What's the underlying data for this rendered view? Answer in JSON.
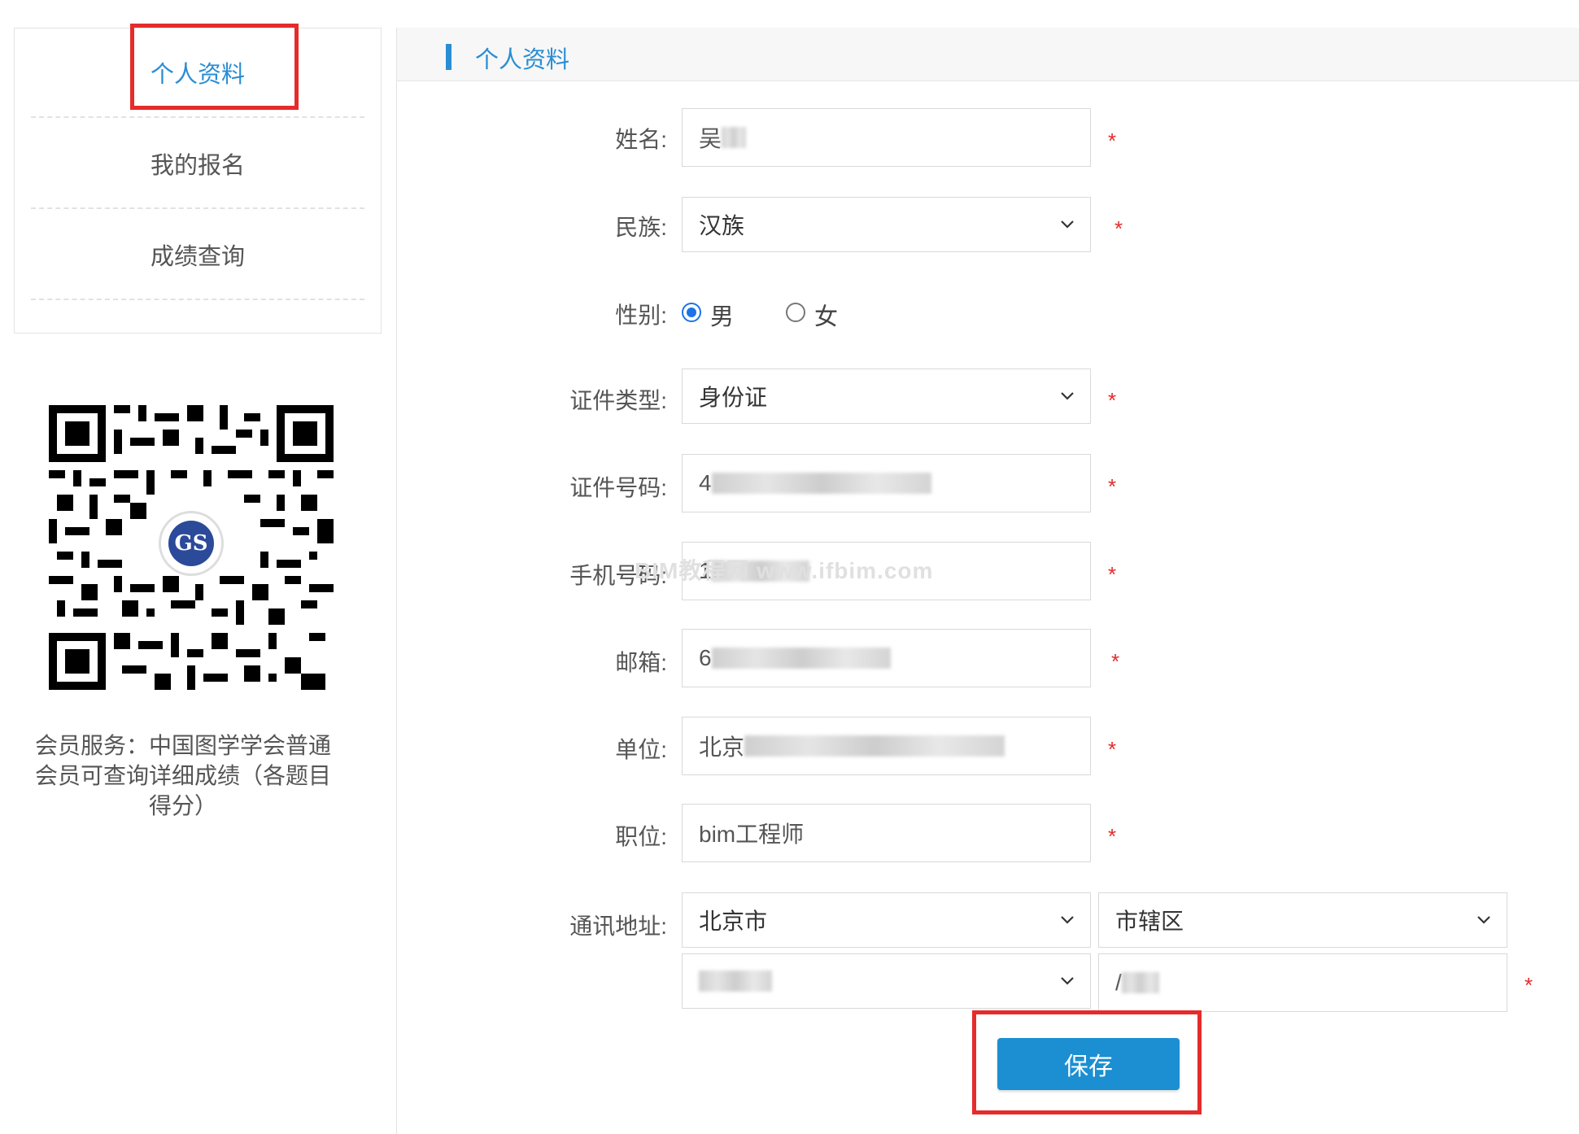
{
  "sidebar": {
    "items": [
      {
        "label": "个人资料",
        "active": true
      },
      {
        "label": "我的报名",
        "active": false
      },
      {
        "label": "成绩查询",
        "active": false
      }
    ]
  },
  "qr": {
    "logo_text": "GS"
  },
  "member_note": "会员服务：中国图学学会普通会员可查询详细成绩（各题目得分）",
  "header": {
    "title": "个人资料"
  },
  "form": {
    "name": {
      "label": "姓名:",
      "value": "吴"
    },
    "ethnicity": {
      "label": "民族:",
      "value": "汉族"
    },
    "gender": {
      "label": "性别:",
      "options": [
        "男",
        "女"
      ],
      "selected": "男"
    },
    "id_type": {
      "label": "证件类型:",
      "value": "身份证"
    },
    "id_number": {
      "label": "证件号码:",
      "value": "4"
    },
    "phone": {
      "label": "手机号码:",
      "value": "1"
    },
    "email": {
      "label": "邮箱:",
      "value": "6"
    },
    "unit": {
      "label": "单位:",
      "value": "北京"
    },
    "position": {
      "label": "职位:",
      "value": "bim工程师"
    },
    "address": {
      "label": "通讯地址:",
      "province": "北京市",
      "city": "市辖区",
      "district": "",
      "detail": "/"
    },
    "required_mark": "*"
  },
  "watermark": "BIM教程网 www.ifbim.com",
  "save_label": "保存",
  "colors": {
    "accent": "#2a8dd4",
    "button": "#1b8fd2",
    "required": "#e52b2b",
    "highlight": "#e52b2b"
  }
}
